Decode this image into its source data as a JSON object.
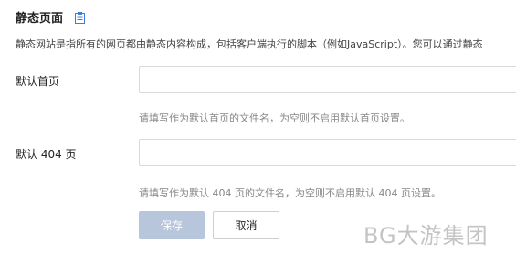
{
  "section": {
    "title": "静态页面",
    "icon": "document-icon",
    "description": "静态网站是指所有的网页都由静态内容构成，包括客户端执行的脚本（例如JavaScript）。您可以通过静态"
  },
  "form": {
    "index_page": {
      "label": "默认首页",
      "value": "",
      "placeholder": "",
      "hint": "请填写作为默认首页的文件名，为空则不启用默认首页设置。"
    },
    "error_page": {
      "label": "默认 404 页",
      "value": "",
      "placeholder": "",
      "hint": "请填写作为默认 404 页的文件名，为空则不启用默认 404 页设置。"
    }
  },
  "actions": {
    "save_label": "保存",
    "cancel_label": "取消"
  },
  "watermark": {
    "text": "BG大游集团"
  },
  "colors": {
    "accent": "#3b7fd6",
    "save_disabled": "#b7c6da",
    "border": "#d9d9d9",
    "hint_text": "#888888"
  }
}
